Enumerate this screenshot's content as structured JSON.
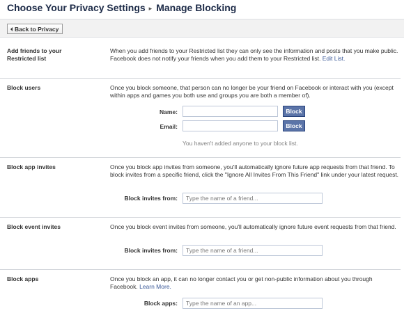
{
  "header": {
    "title": "Choose Your Privacy Settings",
    "separator": "▸",
    "subtitle": "Manage Blocking"
  },
  "back_button": {
    "label": "Back to Privacy"
  },
  "restricted": {
    "label": "Add friends to your Restricted list",
    "description": "When you add friends to your Restricted list they can only see the information and posts that you make public. Facebook does not notify your friends when you add them to your Restricted list.",
    "link": "Edit List."
  },
  "block_users": {
    "label": "Block users",
    "description": "Once you block someone, that person can no longer be your friend on Facebook or interact with you (except within apps and games you both use and groups you are both a member of).",
    "name_label": "Name:",
    "name_value": "",
    "email_label": "Email:",
    "email_value": "",
    "button_label": "Block",
    "empty_message": "You haven't added anyone to your block list."
  },
  "block_app_invites": {
    "label": "Block app invites",
    "description": "Once you block app invites from someone, you'll automatically ignore future app requests from that friend. To block invites from a specific friend, click the \"Ignore All Invites From This Friend\" link under your latest request.",
    "field_label": "Block invites from:",
    "placeholder": "Type the name of a friend..."
  },
  "block_event_invites": {
    "label": "Block event invites",
    "description": "Once you block event invites from someone, you'll automatically ignore future event requests from that friend.",
    "field_label": "Block invites from:",
    "placeholder": "Type the name of a friend..."
  },
  "block_apps": {
    "label": "Block apps",
    "description": "Once you block an app, it can no longer contact you or get non-public information about you through Facebook.",
    "link": "Learn More.",
    "field_label": "Block apps:",
    "placeholder": "Type the name of an app..."
  },
  "colors": {
    "link": "#3b5998",
    "button_bg": "#5b74a8",
    "title": "#1c2a47"
  }
}
